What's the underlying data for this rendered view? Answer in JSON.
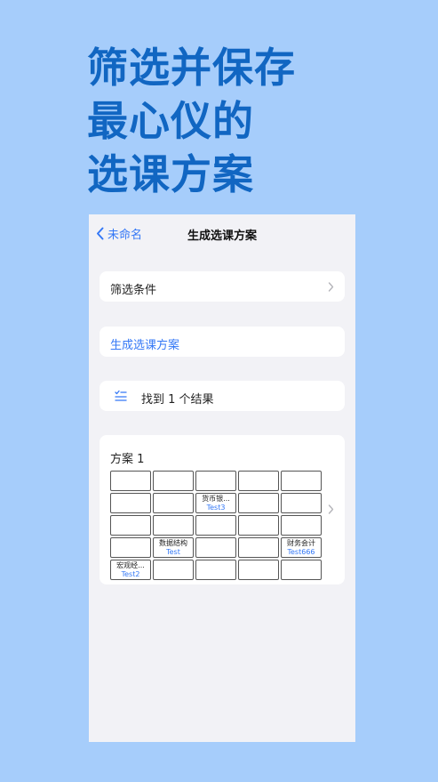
{
  "headline": [
    "筛选并保存",
    "最心仪的",
    "选课方案"
  ],
  "nav": {
    "back_label": "未命名",
    "title": "生成选课方案"
  },
  "filter_row": {
    "label": "筛选条件"
  },
  "generate_row": {
    "label": "生成选课方案"
  },
  "result_row": {
    "label": "找到 1 个结果"
  },
  "plan": {
    "title": "方案 1",
    "cells": [
      {
        "course": "",
        "teacher": ""
      },
      {
        "course": "",
        "teacher": ""
      },
      {
        "course": "",
        "teacher": ""
      },
      {
        "course": "",
        "teacher": ""
      },
      {
        "course": "",
        "teacher": ""
      },
      {
        "course": "",
        "teacher": ""
      },
      {
        "course": "",
        "teacher": ""
      },
      {
        "course": "货币银...",
        "teacher": "Test3"
      },
      {
        "course": "",
        "teacher": ""
      },
      {
        "course": "",
        "teacher": ""
      },
      {
        "course": "",
        "teacher": ""
      },
      {
        "course": "",
        "teacher": ""
      },
      {
        "course": "",
        "teacher": ""
      },
      {
        "course": "",
        "teacher": ""
      },
      {
        "course": "",
        "teacher": ""
      },
      {
        "course": "",
        "teacher": ""
      },
      {
        "course": "数据结构",
        "teacher": "Test"
      },
      {
        "course": "",
        "teacher": ""
      },
      {
        "course": "",
        "teacher": ""
      },
      {
        "course": "财务会计",
        "teacher": "Test666"
      },
      {
        "course": "宏观经...",
        "teacher": "Test2"
      },
      {
        "course": "",
        "teacher": ""
      },
      {
        "course": "",
        "teacher": ""
      },
      {
        "course": "",
        "teacher": ""
      },
      {
        "course": "",
        "teacher": ""
      }
    ]
  },
  "colors": {
    "accent": "#3478f6",
    "headline": "#1166c2",
    "background": "#a6cdfb"
  }
}
